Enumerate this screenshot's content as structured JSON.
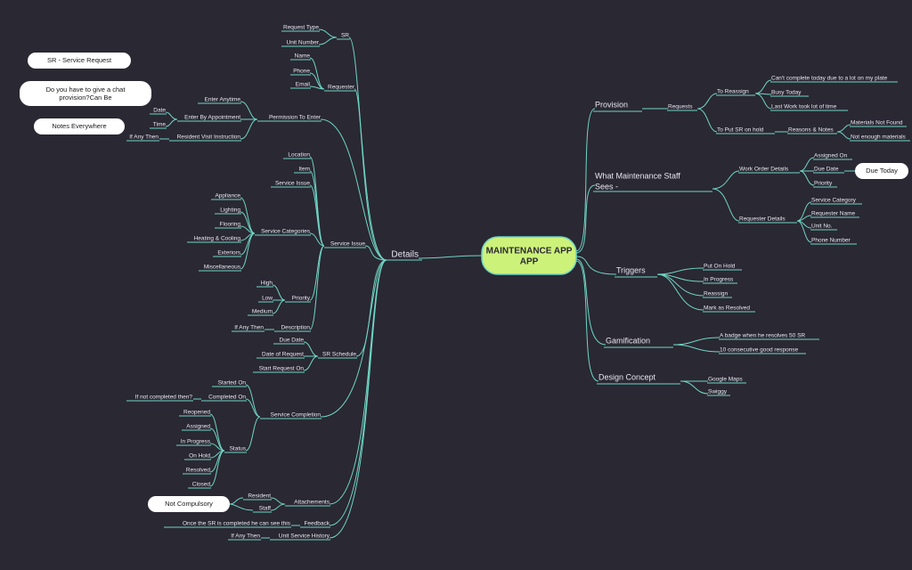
{
  "chart_data": {
    "type": "mindmap",
    "title": "MAINTENANCE APP",
    "notes": [
      "SR - Service Request",
      "Do you have to give a chat provision?Can Be",
      "Notes Everywhere"
    ],
    "left": {
      "label": "Details",
      "children": [
        {
          "label": "SR",
          "children": [
            {
              "label": "Request Type"
            },
            {
              "label": "Unit Number"
            }
          ]
        },
        {
          "label": "Requester",
          "children": [
            {
              "label": "Name"
            },
            {
              "label": "Phone"
            },
            {
              "label": "Email"
            }
          ]
        },
        {
          "label": "Permission To Enter",
          "children": [
            {
              "label": "Enter Anytime"
            },
            {
              "label": "Enter By Appointment",
              "children": [
                {
                  "label": "Date"
                },
                {
                  "label": "Time"
                }
              ]
            },
            {
              "label": "Resident Visit Instruction",
              "children": [
                {
                  "label": "If Any Then"
                }
              ]
            }
          ]
        },
        {
          "label": "Service Issue",
          "children": [
            {
              "label": "Location"
            },
            {
              "label": "Item"
            },
            {
              "label": "Service Issue"
            },
            {
              "label": "Service Categories",
              "children": [
                {
                  "label": "Appliance"
                },
                {
                  "label": "Lighting"
                },
                {
                  "label": "Flooring"
                },
                {
                  "label": "Heating & Cooling"
                },
                {
                  "label": "Exteriors"
                },
                {
                  "label": "Miscellaneous"
                }
              ]
            },
            {
              "label": "Priority",
              "children": [
                {
                  "label": "High"
                },
                {
                  "label": "Low"
                },
                {
                  "label": "Medium"
                }
              ]
            },
            {
              "label": "Description",
              "children": [
                {
                  "label": "If Any Then"
                }
              ]
            }
          ]
        },
        {
          "label": "SR Schedule",
          "children": [
            {
              "label": "Due Date"
            },
            {
              "label": "Date of Request"
            },
            {
              "label": "Start Request On"
            }
          ]
        },
        {
          "label": "Service  Completion",
          "children": [
            {
              "label": "Started On"
            },
            {
              "label": "Completed On",
              "children": [
                {
                  "label": "If not completed then?"
                }
              ]
            },
            {
              "label": "Status",
              "children": [
                {
                  "label": "Reopened"
                },
                {
                  "label": "Assigned"
                },
                {
                  "label": "In Progress"
                },
                {
                  "label": "On Hold"
                },
                {
                  "label": "Resolved"
                },
                {
                  "label": "Closed"
                }
              ]
            }
          ]
        },
        {
          "label": "Attachements",
          "note": "Not Compulsory",
          "children": [
            {
              "label": "Resident"
            },
            {
              "label": "Staff"
            }
          ]
        },
        {
          "label": "Feedback",
          "children": [
            {
              "label": "Once the SR is completed he can see this"
            }
          ]
        },
        {
          "label": "Unit Service History",
          "children": [
            {
              "label": "If Any Then"
            }
          ]
        }
      ]
    },
    "right": [
      {
        "label": "Provision",
        "children": [
          {
            "label": "Requests",
            "children": [
              {
                "label": "To Reassign",
                "children": [
                  {
                    "label": "Can't complete today due to a lot on my plate"
                  },
                  {
                    "label": "Busy Today"
                  },
                  {
                    "label": "Last Work took lot of time"
                  }
                ]
              },
              {
                "label": "To Put SR on hold",
                "children": [
                  {
                    "label": "Reasons & Notes",
                    "children": [
                      {
                        "label": "Materials Not Found"
                      },
                      {
                        "label": "Not enough materials"
                      }
                    ]
                  }
                ]
              }
            ]
          }
        ]
      },
      {
        "label": "What Maintenance Staff Sees -",
        "note": "Due Today",
        "children": [
          {
            "label": "Work Order Details",
            "children": [
              {
                "label": "Assigned On"
              },
              {
                "label": "Due Date"
              },
              {
                "label": "Priority"
              }
            ]
          },
          {
            "label": "Requester Details",
            "children": [
              {
                "label": "Service Category"
              },
              {
                "label": "Requester Name"
              },
              {
                "label": "Unit No."
              },
              {
                "label": "Phone Number"
              }
            ]
          }
        ]
      },
      {
        "label": "Triggers",
        "children": [
          {
            "label": "Put On Hold"
          },
          {
            "label": "In Progress"
          },
          {
            "label": "Reassign"
          },
          {
            "label": "Mark as Resolved"
          }
        ]
      },
      {
        "label": "Gamification",
        "children": [
          {
            "label": "A badge when he resolves 50 SR"
          },
          {
            "label": "10 consecutive good response"
          }
        ]
      },
      {
        "label": "Design Concept",
        "children": [
          {
            "label": "Google Maps"
          },
          {
            "label": "Swiggy"
          }
        ]
      }
    ]
  }
}
